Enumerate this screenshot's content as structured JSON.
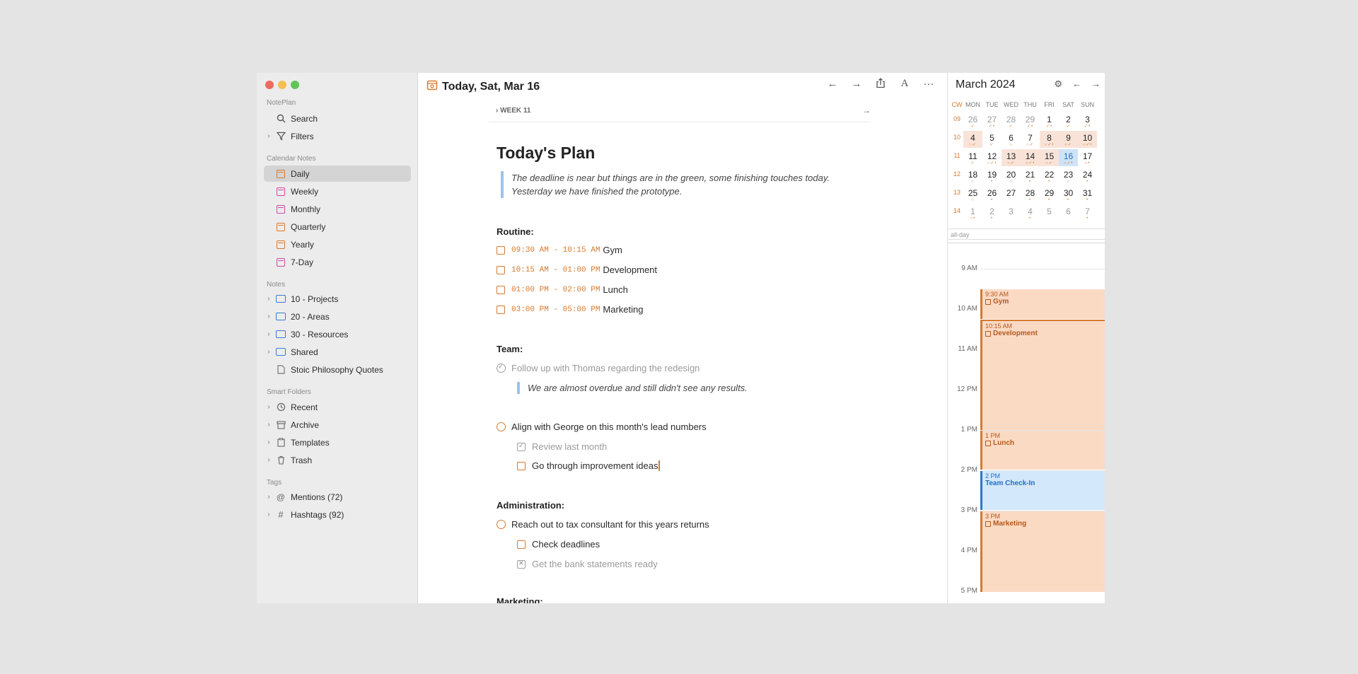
{
  "sidebar": {
    "app_section": "NotePlan",
    "search": "Search",
    "filters": "Filters",
    "calendar_section": "Calendar Notes",
    "calendar_items": [
      "Daily",
      "Weekly",
      "Monthly",
      "Quarterly",
      "Yearly",
      "7-Day"
    ],
    "notes_section": "Notes",
    "notes_items": [
      "10 - Projects",
      "20 - Areas",
      "30 - Resources",
      "Shared",
      "Stoic Philosophy Quotes"
    ],
    "smart_section": "Smart Folders",
    "smart_items": [
      "Recent",
      "Archive",
      "Templates",
      "Trash"
    ],
    "tags_section": "Tags",
    "tags_items": [
      "Mentions (72)",
      "Hashtags (92)"
    ]
  },
  "editor": {
    "title": "Today, Sat, Mar 16",
    "week": "WEEK 11",
    "heading": "Today's Plan",
    "quote_line1": "The deadline is near but things are in the green, some finishing touches today.",
    "quote_line2": "Yesterday we have finished the prototype.",
    "routine": {
      "heading": "Routine:",
      "items": [
        {
          "time": "09:30 AM - 10:15 AM",
          "text": "Gym"
        },
        {
          "time": "10:15 AM - 01:00 PM",
          "text": "Development"
        },
        {
          "time": "01:00 PM - 02:00 PM",
          "text": "Lunch"
        },
        {
          "time": "03:00 PM - 05:00 PM",
          "text": "Marketing"
        }
      ]
    },
    "team": {
      "heading": "Team:",
      "item1": "Follow up with Thomas regarding the redesign",
      "item1_quote": "We are almost overdue and still didn't see any results.",
      "item2": "Align with George on this month's lead numbers",
      "sub1": "Review last month",
      "sub2": "Go through improvement ideas"
    },
    "admin": {
      "heading": "Administration:",
      "item1": "Reach out to tax consultant for this years returns",
      "sub1": "Check deadlines",
      "sub2": "Get the bank statements ready"
    },
    "marketing_heading": "Marketing:"
  },
  "calendar": {
    "month_title": "March 2024",
    "day_headers": [
      "CW",
      "MON",
      "TUE",
      "WED",
      "THU",
      "FRI",
      "SAT",
      "SUN"
    ],
    "weeks": [
      {
        "cw": "09",
        "days": [
          "26",
          "27",
          "28",
          "29",
          "1",
          "2",
          "3"
        ]
      },
      {
        "cw": "10",
        "days": [
          "4",
          "5",
          "6",
          "7",
          "8",
          "9",
          "10"
        ]
      },
      {
        "cw": "11",
        "days": [
          "11",
          "12",
          "13",
          "14",
          "15",
          "16",
          "17"
        ]
      },
      {
        "cw": "12",
        "days": [
          "18",
          "19",
          "20",
          "21",
          "22",
          "23",
          "24"
        ]
      },
      {
        "cw": "13",
        "days": [
          "25",
          "26",
          "27",
          "28",
          "29",
          "30",
          "31"
        ]
      },
      {
        "cw": "14",
        "days": [
          "1",
          "2",
          "3",
          "4",
          "5",
          "6",
          "7"
        ]
      }
    ],
    "all_day": "all-day",
    "hours": [
      "9 AM",
      "10 AM",
      "11 AM",
      "12 PM",
      "1 PM",
      "2 PM",
      "3 PM",
      "4 PM",
      "5 PM"
    ],
    "events": [
      {
        "time": "9:30 AM",
        "title": "Gym"
      },
      {
        "time": "10:15 AM",
        "title": "Development"
      },
      {
        "time": "1 PM",
        "title": "Lunch"
      },
      {
        "time": "2 PM",
        "title": "Team Check-In"
      },
      {
        "time": "3 PM",
        "title": "Marketing"
      }
    ]
  },
  "colors": {
    "accent": "#d6792e",
    "today": "#cfe3f7",
    "event_fill": "#fbdac4",
    "event_blue": "#d4e8fb"
  }
}
